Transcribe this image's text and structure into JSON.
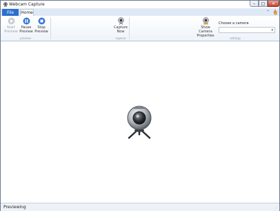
{
  "window": {
    "title": "Webcam Capture"
  },
  "window_controls": {
    "minimize": "–",
    "maximize": "□",
    "close": "✕"
  },
  "tabs": {
    "file": "File",
    "home": "Home"
  },
  "ribbon_controls": {
    "minimize_ribbon": "⌃"
  },
  "ribbon": {
    "preview_group": {
      "label": "preview",
      "buttons": [
        {
          "label": "Start Preview",
          "enabled": false
        },
        {
          "label": "Pause Preview",
          "enabled": true
        },
        {
          "label": "Stop Preview",
          "enabled": true
        }
      ]
    },
    "capture_group": {
      "label": "capture",
      "buttons": [
        {
          "label": "Capture Now",
          "enabled": true
        }
      ]
    },
    "settings_group": {
      "label": "settings",
      "show_camera_properties": "Show Camera Properties",
      "choose_camera_label": "Choose a camera",
      "camera_select_value": ""
    }
  },
  "status": {
    "text": "Previewing"
  },
  "colors": {
    "accent": "#2a6fd0",
    "ribbon_border": "#b6c4d6"
  }
}
